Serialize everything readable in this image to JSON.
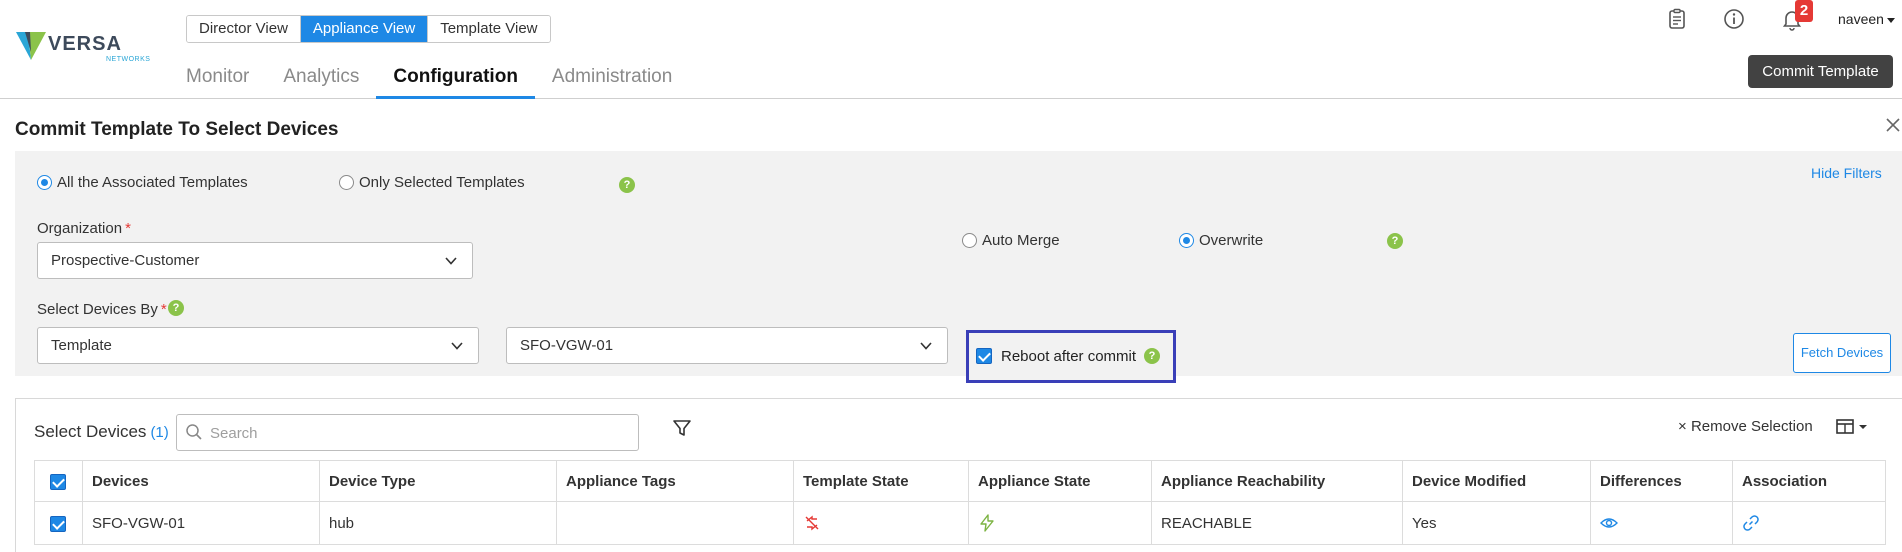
{
  "brand": {
    "name": "VERSA",
    "sub": "NETWORKS",
    "colors": {
      "primary": "#1e88e5",
      "accent_green": "#8bc34a",
      "alert_red": "#e53935",
      "dark_button": "#424242",
      "highlight_border": "#3a3fb8"
    }
  },
  "view_switch": [
    {
      "label": "Director View",
      "active": false
    },
    {
      "label": "Appliance View",
      "active": true
    },
    {
      "label": "Template View",
      "active": false
    }
  ],
  "main_nav": [
    {
      "label": "Monitor",
      "active": false
    },
    {
      "label": "Analytics",
      "active": false
    },
    {
      "label": "Configuration",
      "active": true
    },
    {
      "label": "Administration",
      "active": false
    }
  ],
  "header": {
    "icons": [
      "clipboard-icon",
      "info-icon",
      "bell-icon"
    ],
    "notification_count": "2",
    "user": "naveen",
    "commit_button": "Commit Template"
  },
  "dialog": {
    "title": "Commit Template To Select Devices",
    "hide_filters": "Hide Filters",
    "template_scope": {
      "options": [
        "All the Associated Templates",
        "Only Selected Templates"
      ],
      "selected": "All the Associated Templates"
    },
    "organization": {
      "label": "Organization",
      "required_mark": "*",
      "value": "Prospective-Customer"
    },
    "merge_mode": {
      "options": [
        "Auto Merge",
        "Overwrite"
      ],
      "selected": "Overwrite"
    },
    "select_devices_by": {
      "label": "Select Devices By",
      "required_mark": "*",
      "value": "Template",
      "template_value": "SFO-VGW-01"
    },
    "reboot": {
      "label": "Reboot after commit",
      "checked": true
    },
    "fetch_button": "Fetch Devices",
    "help_glyph": "?"
  },
  "devices": {
    "title": "Select Devices",
    "count": "(1)",
    "search_placeholder": "Search",
    "remove_selection": "Remove Selection",
    "remove_glyph": "×",
    "columns": [
      "Devices",
      "Device Type",
      "Appliance Tags",
      "Template State",
      "Appliance State",
      "Appliance Reachability",
      "Device Modified",
      "Differences",
      "Association"
    ],
    "rows": [
      {
        "selected": true,
        "device": "SFO-VGW-01",
        "device_type": "hub",
        "appliance_tags": "",
        "template_state_icon": "out-of-sync-icon",
        "appliance_state_icon": "power-on-icon",
        "reachability": "REACHABLE",
        "device_modified": "Yes",
        "differences_icon": "eye-icon",
        "association_icon": "link-icon"
      }
    ]
  }
}
